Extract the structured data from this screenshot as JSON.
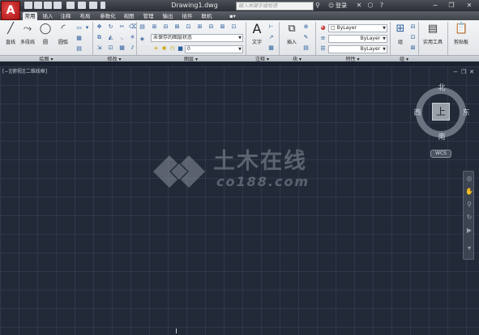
{
  "app": {
    "logo_glyph": "A",
    "document_title": "Drawing1.dwg"
  },
  "search": {
    "placeholder": "键入关键字或短语"
  },
  "account": {
    "login_label": "登录"
  },
  "tabs": [
    "常用",
    "插入",
    "注释",
    "布局",
    "参数化",
    "视图",
    "管理",
    "输出",
    "插件",
    "联机"
  ],
  "active_tab": "常用",
  "ribbon": {
    "draw": {
      "line": "直线",
      "polyline": "多段线",
      "circle": "圆",
      "arc": "圆弧"
    },
    "layer_state": "未保存的图层状态",
    "layer_current": "0",
    "annotation": {
      "text": "文字"
    },
    "block": {
      "insert": "插入"
    },
    "properties": {
      "color": "ByLayer",
      "linetype": "ByLayer",
      "lineweight": "ByLayer"
    },
    "group": {
      "group": "组"
    },
    "utilities": {
      "label": "实用工具"
    },
    "clipboard": {
      "label": "剪贴板"
    }
  },
  "panels": {
    "draw": "绘图",
    "modify": "修改",
    "layers": "图层",
    "annotation": "注释",
    "block": "块",
    "properties": "特性",
    "group": "组"
  },
  "viewport": {
    "label": "[−][俯视][二维线框]"
  },
  "viewcube": {
    "north": "北",
    "south": "南",
    "east": "东",
    "west": "西",
    "face": "上",
    "wcs": "WCS"
  },
  "watermark": {
    "name": "土木在线",
    "url": "co188.com"
  },
  "colors": {
    "canvas": "#222a38",
    "ribbon": "#e9ecef",
    "logo": "#c62020"
  }
}
